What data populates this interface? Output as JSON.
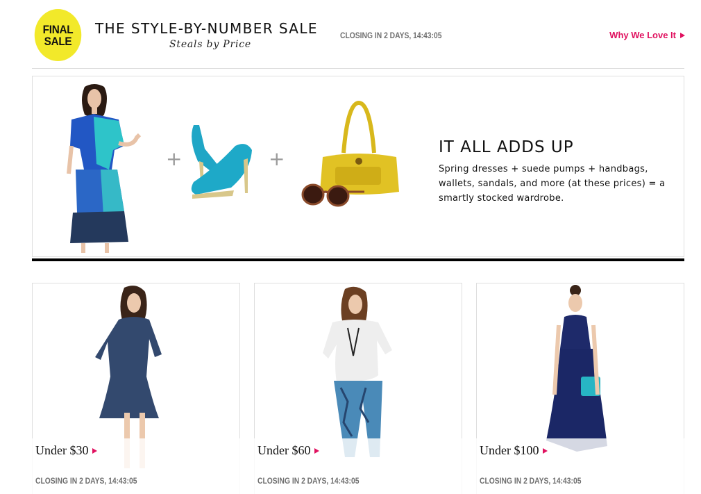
{
  "header": {
    "badge_line1": "FINAL",
    "badge_line2": "SALE",
    "title": "THE STYLE-BY-NUMBER SALE",
    "subtitle": "Steals by Price",
    "countdown": "CLOSING IN 2 DAYS, 14:43:05",
    "why_link": "Why We Love It"
  },
  "hero": {
    "plus_1": "+",
    "plus_2": "+",
    "heading": "IT ALL ADDS UP",
    "body": "Spring dresses + suede pumps + handbags, wallets, sandals, and more (at these prices) = a smartly stocked wardrobe."
  },
  "cards": [
    {
      "label": "Under $30",
      "countdown": "CLOSING IN 2 DAYS, 14:43:05"
    },
    {
      "label": "Under $60",
      "countdown": "CLOSING IN 2 DAYS, 14:43:05"
    },
    {
      "label": "Under $100",
      "countdown": "CLOSING IN 2 DAYS, 14:43:05"
    }
  ],
  "colors": {
    "badge_yellow": "#f2e92a",
    "accent_pink": "#e0115f",
    "countdown_gray": "#6f6f6f"
  }
}
